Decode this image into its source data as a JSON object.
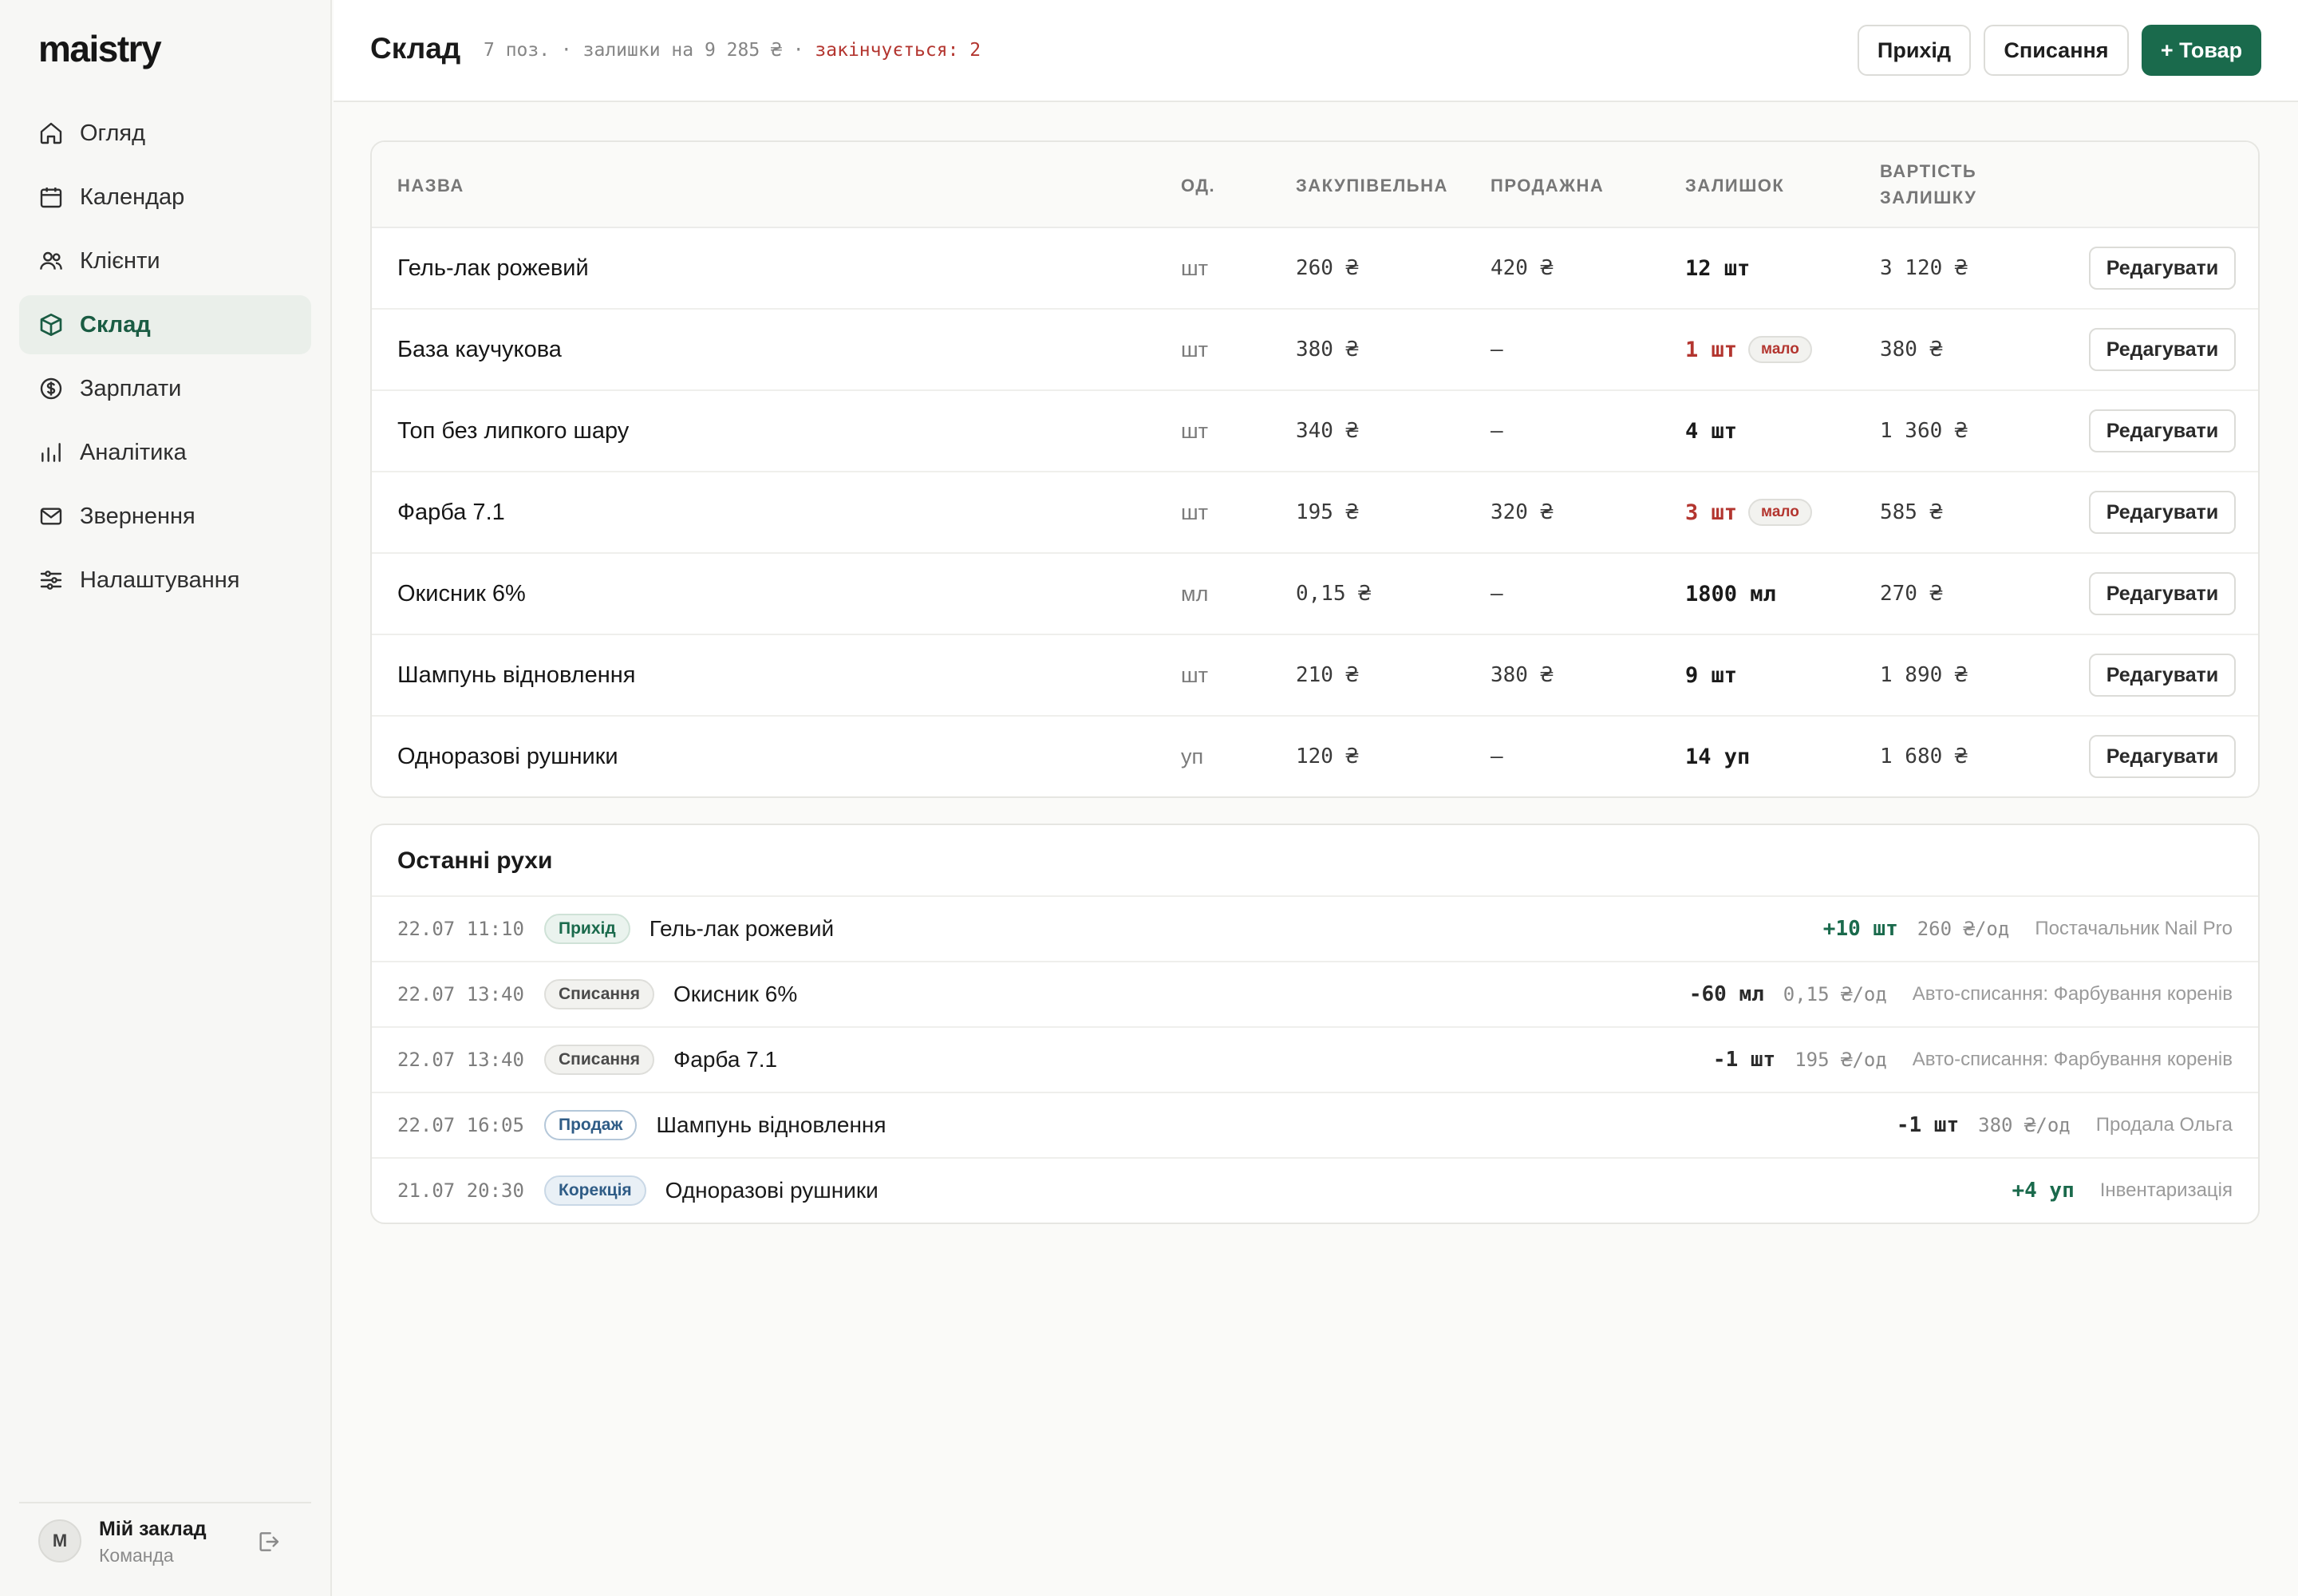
{
  "app": {
    "logo": "maistry"
  },
  "sidebar": {
    "items": [
      {
        "label": "Огляд",
        "icon": "home-icon"
      },
      {
        "label": "Календар",
        "icon": "calendar-icon"
      },
      {
        "label": "Клієнти",
        "icon": "users-icon"
      },
      {
        "label": "Склад",
        "icon": "box-icon",
        "active": true
      },
      {
        "label": "Зарплати",
        "icon": "dollar-icon"
      },
      {
        "label": "Аналітика",
        "icon": "bar-chart-icon"
      },
      {
        "label": "Звернення",
        "icon": "mail-icon"
      },
      {
        "label": "Налаштування",
        "icon": "sliders-icon"
      }
    ],
    "footer": {
      "avatar": "М",
      "name": "Мій заклад",
      "role": "Команда"
    }
  },
  "header": {
    "title": "Склад",
    "meta": "7 поз. · залишки на 9 285 ₴ · ",
    "meta_warn": "закінчується: 2",
    "buttons": {
      "income": "Прихід",
      "writeoff": "Списання",
      "add": "+ Товар"
    }
  },
  "colors": {
    "accent": "#1a6a4c",
    "warn": "#b3352f",
    "info": "#2f5c86"
  },
  "table": {
    "headers": {
      "name": "НАЗВА",
      "unit": "ОД.",
      "buy": "ЗАКУПІВЕЛЬНА",
      "sell": "ПРОДАЖНА",
      "stock": "ЗАЛИШОК",
      "value_1": "ВАРТІСТЬ",
      "value_2": "ЗАЛИШКУ"
    },
    "edit_label": "Редагувати",
    "low_label": "мало",
    "rows": [
      {
        "name": "Гель-лак рожевий",
        "unit": "шт",
        "buy": "260 ₴",
        "sell": "420 ₴",
        "stock": "12 шт",
        "low": false,
        "value": "3 120 ₴"
      },
      {
        "name": "База каучукова",
        "unit": "шт",
        "buy": "380 ₴",
        "sell": "—",
        "stock": "1 шт",
        "low": true,
        "value": "380 ₴"
      },
      {
        "name": "Топ без липкого шару",
        "unit": "шт",
        "buy": "340 ₴",
        "sell": "—",
        "stock": "4 шт",
        "low": false,
        "value": "1 360 ₴"
      },
      {
        "name": "Фарба 7.1",
        "unit": "шт",
        "buy": "195 ₴",
        "sell": "320 ₴",
        "stock": "3 шт",
        "low": true,
        "value": "585 ₴"
      },
      {
        "name": "Окисник 6%",
        "unit": "мл",
        "buy": "0,15 ₴",
        "sell": "—",
        "stock": "1800 мл",
        "low": false,
        "value": "270 ₴"
      },
      {
        "name": "Шампунь відновлення",
        "unit": "шт",
        "buy": "210 ₴",
        "sell": "380 ₴",
        "stock": "9 шт",
        "low": false,
        "value": "1 890 ₴"
      },
      {
        "name": "Одноразові рушники",
        "unit": "уп",
        "buy": "120 ₴",
        "sell": "—",
        "stock": "14 уп",
        "low": false,
        "value": "1 680 ₴"
      }
    ]
  },
  "movements": {
    "title": "Останні рухи",
    "rows": [
      {
        "time": "22.07 11:10",
        "type": "Прихід",
        "kind": "in",
        "item": "Гель-лак рожевий",
        "qty": "+10 шт",
        "sign": "pos",
        "price": "260 ₴/од",
        "note": "Постачальник Nail Pro"
      },
      {
        "time": "22.07 13:40",
        "type": "Списання",
        "kind": "out",
        "item": "Окисник 6%",
        "qty": "-60 мл",
        "sign": "neg",
        "price": "0,15 ₴/од",
        "note": "Авто-списання: Фарбування коренів"
      },
      {
        "time": "22.07 13:40",
        "type": "Списання",
        "kind": "out",
        "item": "Фарба 7.1",
        "qty": "-1 шт",
        "sign": "neg",
        "price": "195 ₴/од",
        "note": "Авто-списання: Фарбування коренів"
      },
      {
        "time": "22.07 16:05",
        "type": "Продаж",
        "kind": "sale",
        "item": "Шампунь відновлення",
        "qty": "-1 шт",
        "sign": "neg",
        "price": "380 ₴/од",
        "note": "Продала Ольга"
      },
      {
        "time": "21.07 20:30",
        "type": "Корекція",
        "kind": "fix",
        "item": "Одноразові рушники",
        "qty": "+4 уп",
        "sign": "pos",
        "price": "",
        "note": "Інвентаризація"
      }
    ]
  }
}
